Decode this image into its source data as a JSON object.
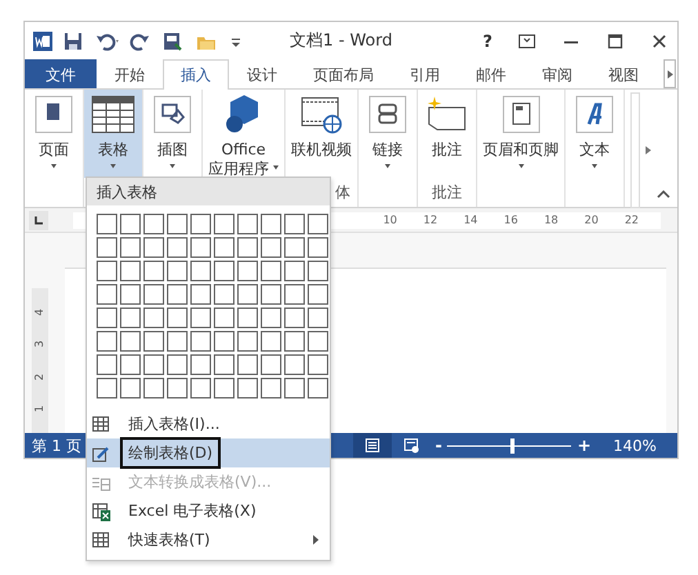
{
  "window": {
    "title": "文档1 - Word"
  },
  "quick_access": [
    {
      "kind": "save"
    },
    {
      "kind": "undo"
    },
    {
      "kind": "redo"
    },
    {
      "kind": "preview"
    },
    {
      "kind": "folder"
    },
    {
      "kind": "customize"
    }
  ],
  "window_controls": [
    {
      "kind": "help",
      "label": "?"
    },
    {
      "kind": "ribbon-options"
    },
    {
      "kind": "minimize"
    },
    {
      "kind": "maximize"
    },
    {
      "kind": "close"
    }
  ],
  "tabs": [
    {
      "label": "文件",
      "kind": "file",
      "selected": false
    },
    {
      "label": "开始",
      "selected": false
    },
    {
      "label": "插入",
      "selected": true
    },
    {
      "label": "设计",
      "selected": false
    },
    {
      "label": "页面布局",
      "selected": false
    },
    {
      "label": "引用",
      "selected": false
    },
    {
      "label": "邮件",
      "selected": false
    },
    {
      "label": "审阅",
      "selected": false
    },
    {
      "label": "视图",
      "selected": false
    }
  ],
  "ribbon_groups": [
    {
      "commands": [
        {
          "lines": [
            "页面"
          ],
          "caret": true,
          "selected": false
        }
      ]
    },
    {
      "commands": [
        {
          "lines": [
            "表格"
          ],
          "caret": true,
          "selected": true
        }
      ]
    },
    {
      "commands": [
        {
          "lines": [
            "插图"
          ],
          "caret": true,
          "selected": false
        }
      ]
    },
    {
      "commands": [
        {
          "lines": [
            "Office",
            "应用程序"
          ],
          "caret": true,
          "selected": false
        }
      ]
    },
    {
      "label": "体",
      "commands": [
        {
          "lines": [
            "联机视频"
          ],
          "caret": false,
          "selected": false
        }
      ]
    },
    {
      "commands": [
        {
          "lines": [
            "链接"
          ],
          "caret": true,
          "selected": false
        }
      ]
    },
    {
      "label": "批注",
      "commands": [
        {
          "lines": [
            "批注"
          ],
          "caret": false,
          "selected": false
        }
      ]
    },
    {
      "commands": [
        {
          "lines": [
            "页眉和页脚"
          ],
          "caret": true,
          "selected": false
        }
      ]
    },
    {
      "commands": [
        {
          "lines": [
            "文本"
          ],
          "caret": true,
          "selected": false
        }
      ]
    }
  ],
  "ruler": {
    "numbers": [
      "10",
      "12",
      "14",
      "16",
      "18",
      "20",
      "22"
    ],
    "vertical_numbers": [
      "4",
      "3",
      "2",
      "1"
    ]
  },
  "table_menu": {
    "header": "插入表格",
    "items": [
      {
        "kind": "table",
        "label": "插入表格(I)...",
        "selected": false,
        "disabled": false,
        "submenu": false,
        "outlined": false
      },
      {
        "kind": "pencil",
        "label": "绘制表格(D)",
        "selected": true,
        "disabled": false,
        "submenu": false,
        "outlined": true
      },
      {
        "kind": "convert",
        "label": "文本转换成表格(V)...",
        "selected": false,
        "disabled": true,
        "submenu": false,
        "outlined": false
      },
      {
        "kind": "excel",
        "label": "Excel 电子表格(X)",
        "selected": false,
        "disabled": false,
        "submenu": false,
        "outlined": false
      },
      {
        "kind": "table",
        "label": "快速表格(T)",
        "selected": false,
        "disabled": false,
        "submenu": true,
        "outlined": false
      }
    ]
  },
  "status_bar": {
    "page": "第 1 页",
    "zoom": {
      "minus": "-",
      "plus": "+",
      "level": 0.52,
      "reading": "140%"
    }
  }
}
